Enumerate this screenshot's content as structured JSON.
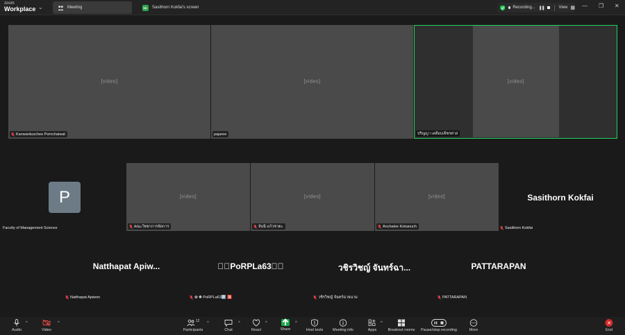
{
  "titlebar": {
    "brand_line1": "zoom",
    "brand_line2": "Workplace",
    "meeting_tab": "Meeting",
    "share_tab": "Sasithorn Kokfai's screen",
    "share_badge": "SK",
    "recording_label": "Recording...",
    "view_label": "View"
  },
  "tiles": [
    {
      "name": "Kanwantuschee Pornchaiwat",
      "muted": true
    },
    {
      "name": "pajaree",
      "muted": false
    },
    {
      "name": "ปริญญา เคลือบเพ็ชรศาส",
      "muted": false
    },
    {
      "name": "Faculty of Management Science",
      "muted": false,
      "avatar_letter": "P"
    },
    {
      "name": "คณะวิทยาการจัดการ",
      "muted": true
    },
    {
      "name": "จันนี แก้วชาตะ",
      "muted": true
    },
    {
      "name": "Anchalee Kokanuch",
      "muted": true
    },
    {
      "name": "Sasithorn Kokfai",
      "muted": true,
      "display_name": "Sasithorn Kokfai"
    }
  ],
  "bottom_participants": [
    {
      "display_name": "Natthapat  Apiw...",
      "label": "Natthapat Apiwon"
    },
    {
      "display_name": "\u0000\u0000PoRPLa63\u0000\u0000",
      "label": "✿ ✽ PoRPLa63🈳 🈵"
    },
    {
      "display_name": "วชิรวิชญ์ จันทร์ฉา...",
      "label": "วชิรวิชญ์ จันทร์ฉายนาม"
    },
    {
      "display_name": "PATTARAPAN",
      "label": "PATTARAPAN"
    }
  ],
  "toolbar": {
    "audio": "Audio",
    "video": "Video",
    "participants": "Participants",
    "participants_count": "12",
    "chat": "Chat",
    "react": "React",
    "share": "Share",
    "host_tools": "Host tools",
    "meeting_info": "Meeting info",
    "apps": "Apps",
    "breakout": "Breakout rooms",
    "pause_stop": "Pause/stop recording",
    "more": "More",
    "end": "End"
  },
  "colors": {
    "active_speaker": "#23d160",
    "end": "#d22a2a",
    "share": "#1aaa46"
  }
}
